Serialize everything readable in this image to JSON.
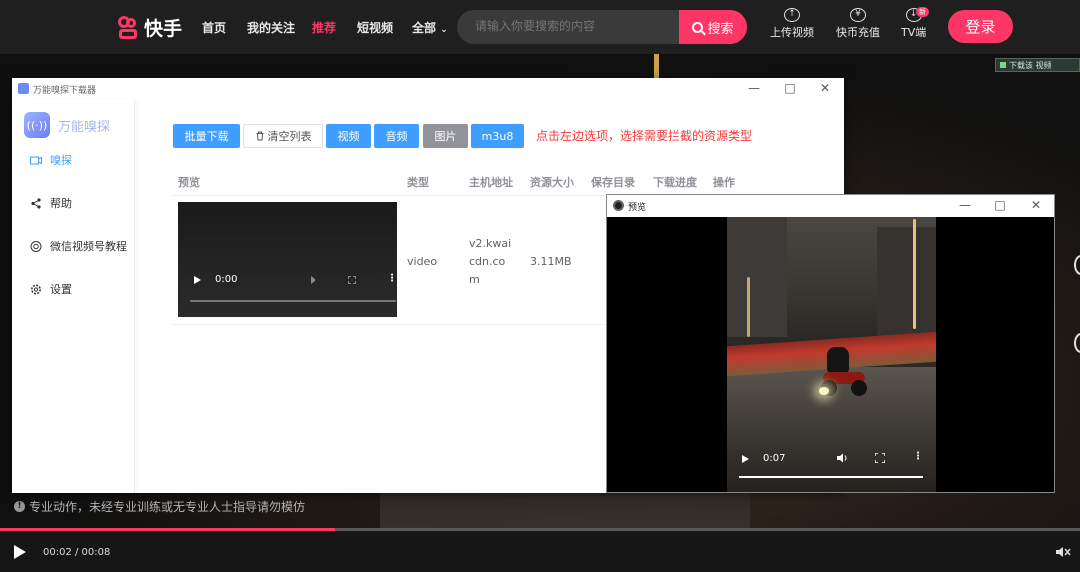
{
  "site": {
    "logo_text": "快手",
    "nav": [
      "首页",
      "我的关注",
      "推荐",
      "短视频",
      "全部"
    ],
    "nav_active": "推荐",
    "search_placeholder": "请输入你要搜索的内容",
    "search_button": "搜索",
    "upload": "上传视频",
    "recharge": "快币充值",
    "tv": "TV端",
    "tv_badge": "新",
    "login": "登录",
    "download_pill": "下载该 视频",
    "warning": "专业动作，未经专业训练或无专业人士指导请勿模仿",
    "player_time": "00:02 / 00:08",
    "progress": 0.31,
    "accent": "#fe3666"
  },
  "sniffer": {
    "title": "万能嗅探下载器",
    "brand": "万能嗅探",
    "side_items": [
      "嗅探",
      "帮助",
      "微信视频号教程",
      "设置"
    ],
    "toolbar": {
      "batch_download": "批量下载",
      "clear_list": "清空列表",
      "video": "视频",
      "audio": "音频",
      "image": "图片",
      "m3u8": "m3u8"
    },
    "hint": "点击左边选项，选择需要拦截的资源类型",
    "columns": [
      "预览",
      "类型",
      "主机地址",
      "资源大小",
      "保存目录",
      "下载进度",
      "操作"
    ],
    "row": {
      "type": "video",
      "host": "v2.kwaicdn.com",
      "host_lines": [
        "v2.kwai",
        "cdn.co",
        "m"
      ],
      "size": "3.11MB",
      "thumb_time": "0:00"
    },
    "accent": "#409eff",
    "hint_color": "#f23c3c"
  },
  "preview": {
    "title": "预览",
    "time": "0:07",
    "progress": 1.0
  }
}
